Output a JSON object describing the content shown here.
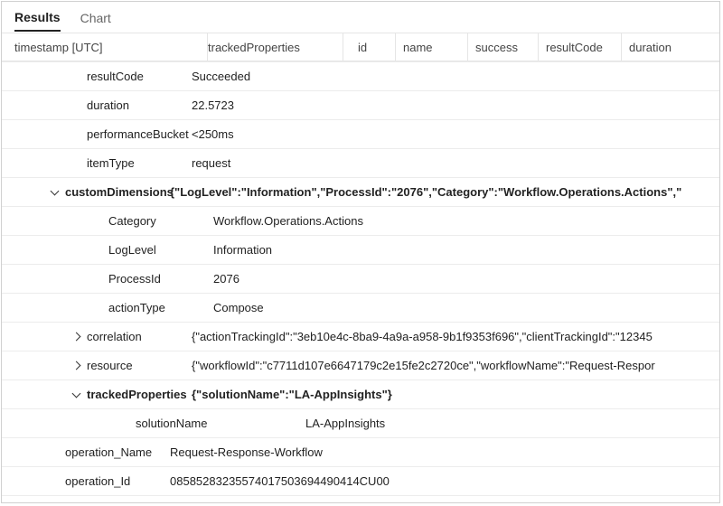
{
  "tabs": {
    "results": "Results",
    "chart": "Chart"
  },
  "columns": {
    "timestamp": "timestamp [UTC]",
    "trackedProperties": "trackedProperties",
    "id": "id",
    "name": "name",
    "success": "success",
    "resultCode": "resultCode",
    "duration": "duration"
  },
  "rows": {
    "resultCode": {
      "k": "resultCode",
      "v": "Succeeded"
    },
    "duration": {
      "k": "duration",
      "v": "22.5723"
    },
    "performanceBucket": {
      "k": "performanceBucket",
      "v": "<250ms"
    },
    "itemType": {
      "k": "itemType",
      "v": "request"
    },
    "customDimensions": {
      "k": "customDimensions",
      "v": "{\"LogLevel\":\"Information\",\"ProcessId\":\"2076\",\"Category\":\"Workflow.Operations.Actions\",\""
    },
    "category": {
      "k": "Category",
      "v": "Workflow.Operations.Actions"
    },
    "logLevel": {
      "k": "LogLevel",
      "v": "Information"
    },
    "processId": {
      "k": "ProcessId",
      "v": "2076"
    },
    "actionType": {
      "k": "actionType",
      "v": "Compose"
    },
    "correlation": {
      "k": "correlation",
      "v": "{\"actionTrackingId\":\"3eb10e4c-8ba9-4a9a-a958-9b1f9353f696\",\"clientTrackingId\":\"12345"
    },
    "resource": {
      "k": "resource",
      "v": "{\"workflowId\":\"c7711d107e6647179c2e15fe2c2720ce\",\"workflowName\":\"Request-Respor"
    },
    "trackedProperties": {
      "k": "trackedProperties",
      "v": "{\"solutionName\":\"LA-AppInsights\"}"
    },
    "solutionName": {
      "k": "solutionName",
      "v": "LA-AppInsights"
    },
    "operation_Name": {
      "k": "operation_Name",
      "v": "Request-Response-Workflow"
    },
    "operation_Id": {
      "k": "operation_Id",
      "v": "08585283235574017503694490414CU00"
    }
  }
}
